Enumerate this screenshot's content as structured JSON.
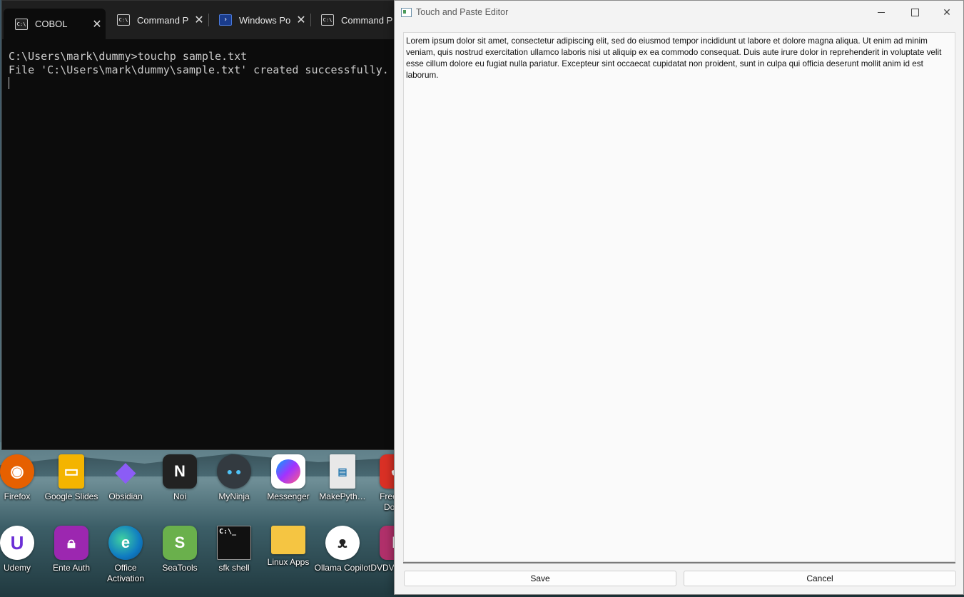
{
  "terminal": {
    "tabs": [
      {
        "label": "COBOL",
        "icon": "cmd-icon"
      },
      {
        "label": "Command P",
        "icon": "cmd-icon"
      },
      {
        "label": "Windows Po",
        "icon": "powershell-icon"
      },
      {
        "label": "Command P",
        "icon": "cmd-icon"
      }
    ],
    "active_tab": 0,
    "lines": [
      "C:\\Users\\mark\\dummy>touchp sample.txt",
      "File 'C:\\Users\\mark\\dummy\\sample.txt' created successfully."
    ]
  },
  "editor": {
    "title": "Touch and Paste Editor",
    "content": "Lorem ipsum dolor sit amet, consectetur adipiscing elit, sed do eiusmod tempor incididunt ut labore et dolore magna aliqua. Ut enim ad minim veniam, quis nostrud exercitation ullamco laboris nisi ut aliquip ex ea commodo consequat. Duis aute irure dolor in reprehenderit in voluptate velit esse cillum dolore eu fugiat nulla pariatur. Excepteur sint occaecat cupidatat non proident, sunt in culpa qui officia deserunt mollit anim id est laborum.",
    "save_label": "Save",
    "cancel_label": "Cancel"
  },
  "desktop": {
    "icons_row1": [
      {
        "label": "Firefox",
        "icon": "firefox-icon",
        "color": "#e66000"
      },
      {
        "label": "Google Slides",
        "icon": "slides-icon",
        "color": "#f4b400"
      },
      {
        "label": "Obsidian",
        "icon": "obsidian-icon",
        "color": "#7c3aed"
      },
      {
        "label": "Noi",
        "icon": "noi-icon",
        "color": "#222222"
      },
      {
        "label": "MyNinja",
        "icon": "ninja-icon",
        "color": "#333a40"
      },
      {
        "label": "Messenger",
        "icon": "messenger-icon",
        "color": "#a033ff"
      },
      {
        "label": "MakePyth…",
        "icon": "file-icon",
        "color": "#e8e8e8"
      },
      {
        "label": "Free Y… Dow…",
        "icon": "downloader-icon",
        "color": "#d93025"
      }
    ],
    "icons_row2": [
      {
        "label": "Udemy",
        "icon": "udemy-icon",
        "color": "#ffffff"
      },
      {
        "label": "Ente Auth",
        "icon": "lock-icon",
        "color": "#9c27b0"
      },
      {
        "label": "Office Activation",
        "icon": "edge-icon",
        "color": "#0f7bc2"
      },
      {
        "label": "SeaTools",
        "icon": "seatools-icon",
        "color": "#6ab04c"
      },
      {
        "label": "sfk shell",
        "icon": "terminal-icon",
        "color": "#111111"
      },
      {
        "label": "Linux Apps",
        "icon": "folder-icon",
        "color": "#f5c542"
      },
      {
        "label": "Ollama Copilot",
        "icon": "ollama-icon",
        "color": "#ffffff"
      },
      {
        "label": "DVDV… Free",
        "icon": "dvd-icon",
        "color": "#b0306a"
      }
    ]
  }
}
